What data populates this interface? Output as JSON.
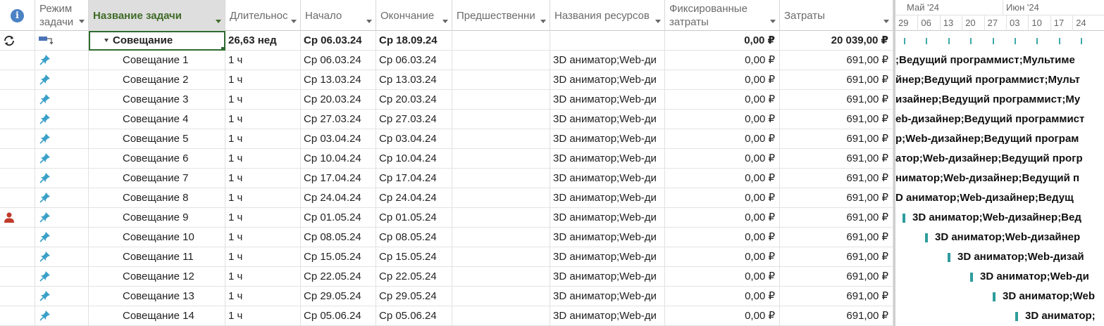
{
  "columns": {
    "info": "",
    "mode": "Режим задачи",
    "name": "Название задачи",
    "duration": "Длительнос",
    "start": "Начало",
    "finish": "Окончание",
    "pred": "Предшественни",
    "resources": "Названия ресурсов",
    "fixed": "Фиксированные затраты",
    "cost": "Затраты"
  },
  "summary": {
    "name": "Совещание",
    "duration": "26,63 нед",
    "start": "Ср 06.03.24",
    "finish": "Ср 18.09.24",
    "pred": "",
    "resources": "",
    "fixed": "0,00 ₽",
    "cost": "20 039,00 ₽"
  },
  "tasks": [
    {
      "name": "Совещание 1",
      "duration": "1 ч",
      "start": "Ср 06.03.24",
      "finish": "Ср 06.03.24",
      "resources": "3D аниматор;Web-ди",
      "fixed": "0,00 ₽",
      "cost": "691,00 ₽",
      "gantt_label": ";Ведущий программист;Мультиме"
    },
    {
      "name": "Совещание 2",
      "duration": "1 ч",
      "start": "Ср 13.03.24",
      "finish": "Ср 13.03.24",
      "resources": "3D аниматор;Web-ди",
      "fixed": "0,00 ₽",
      "cost": "691,00 ₽",
      "gantt_label": "йнер;Ведущий программист;Мульт"
    },
    {
      "name": "Совещание 3",
      "duration": "1 ч",
      "start": "Ср 20.03.24",
      "finish": "Ср 20.03.24",
      "resources": "3D аниматор;Web-ди",
      "fixed": "0,00 ₽",
      "cost": "691,00 ₽",
      "gantt_label": "изайнер;Ведущий программист;Му"
    },
    {
      "name": "Совещание 4",
      "duration": "1 ч",
      "start": "Ср 27.03.24",
      "finish": "Ср 27.03.24",
      "resources": "3D аниматор;Web-ди",
      "fixed": "0,00 ₽",
      "cost": "691,00 ₽",
      "gantt_label": "eb-дизайнер;Ведущий программист"
    },
    {
      "name": "Совещание 5",
      "duration": "1 ч",
      "start": "Ср 03.04.24",
      "finish": "Ср 03.04.24",
      "resources": "3D аниматор;Web-ди",
      "fixed": "0,00 ₽",
      "cost": "691,00 ₽",
      "gantt_label": "р;Web-дизайнер;Ведущий програм"
    },
    {
      "name": "Совещание 6",
      "duration": "1 ч",
      "start": "Ср 10.04.24",
      "finish": "Ср 10.04.24",
      "resources": "3D аниматор;Web-ди",
      "fixed": "0,00 ₽",
      "cost": "691,00 ₽",
      "gantt_label": "атор;Web-дизайнер;Ведущий прогр"
    },
    {
      "name": "Совещание 7",
      "duration": "1 ч",
      "start": "Ср 17.04.24",
      "finish": "Ср 17.04.24",
      "resources": "3D аниматор;Web-ди",
      "fixed": "0,00 ₽",
      "cost": "691,00 ₽",
      "gantt_label": "ниматор;Web-дизайнер;Ведущий п"
    },
    {
      "name": "Совещание 8",
      "duration": "1 ч",
      "start": "Ср 24.04.24",
      "finish": "Ср 24.04.24",
      "resources": "3D аниматор;Web-ди",
      "fixed": "0,00 ₽",
      "cost": "691,00 ₽",
      "gantt_label": "D аниматор;Web-дизайнер;Ведущ"
    },
    {
      "name": "Совещание 9",
      "duration": "1 ч",
      "start": "Ср 01.05.24",
      "finish": "Ср 01.05.24",
      "resources": "3D аниматор;Web-ди",
      "fixed": "0,00 ₽",
      "cost": "691,00 ₽",
      "gantt_label": "3D аниматор;Web-дизайнер;Вед"
    },
    {
      "name": "Совещание 10",
      "duration": "1 ч",
      "start": "Ср 08.05.24",
      "finish": "Ср 08.05.24",
      "resources": "3D аниматор;Web-ди",
      "fixed": "0,00 ₽",
      "cost": "691,00 ₽",
      "gantt_label": "3D аниматор;Web-дизайнер"
    },
    {
      "name": "Совещание 11",
      "duration": "1 ч",
      "start": "Ср 15.05.24",
      "finish": "Ср 15.05.24",
      "resources": "3D аниматор;Web-ди",
      "fixed": "0,00 ₽",
      "cost": "691,00 ₽",
      "gantt_label": "3D аниматор;Web-дизай"
    },
    {
      "name": "Совещание 12",
      "duration": "1 ч",
      "start": "Ср 22.05.24",
      "finish": "Ср 22.05.24",
      "resources": "3D аниматор;Web-ди",
      "fixed": "0,00 ₽",
      "cost": "691,00 ₽",
      "gantt_label": "3D аниматор;Web-ди"
    },
    {
      "name": "Совещание 13",
      "duration": "1 ч",
      "start": "Ср 29.05.24",
      "finish": "Ср 29.05.24",
      "resources": "3D аниматор;Web-ди",
      "fixed": "0,00 ₽",
      "cost": "691,00 ₽",
      "gantt_label": "3D аниматор;Web"
    },
    {
      "name": "Совещание 14",
      "duration": "1 ч",
      "start": "Ср 05.06.24",
      "finish": "Ср 05.06.24",
      "resources": "3D аниматор;Web-ди",
      "fixed": "0,00 ₽",
      "cost": "691,00 ₽",
      "gantt_label": "3D аниматор;"
    }
  ],
  "gantt": {
    "months": [
      "Май '24",
      "Июн '24"
    ],
    "days": [
      "29",
      "06",
      "13",
      "20",
      "27",
      "03",
      "10",
      "17",
      "24"
    ]
  },
  "colors": {
    "selected_header_text": "#3f6b26",
    "bar": "#2e9c9c",
    "info_icon": "#4a82c4",
    "pin_icon": "#3aa0c8",
    "resource_icon": "#c0392b"
  }
}
